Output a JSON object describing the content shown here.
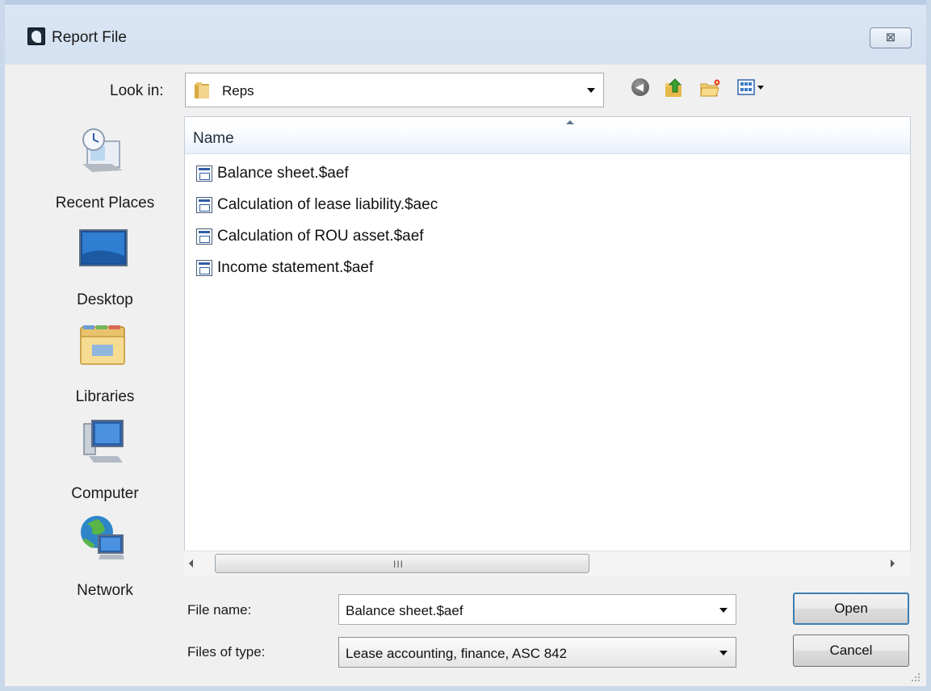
{
  "window": {
    "title": "Report File",
    "close_label": "⊠"
  },
  "look_in": {
    "label": "Look in:",
    "value": "Reps"
  },
  "toolbar": {
    "icons": [
      "back-icon",
      "up-folder-icon",
      "new-folder-icon",
      "views-menu-icon"
    ]
  },
  "places": [
    {
      "label": "Recent Places",
      "icon": "recent-places-icon"
    },
    {
      "label": "Desktop",
      "icon": "desktop-icon"
    },
    {
      "label": "Libraries",
      "icon": "libraries-icon"
    },
    {
      "label": "Computer",
      "icon": "computer-icon"
    },
    {
      "label": "Network",
      "icon": "network-icon"
    }
  ],
  "file_list": {
    "column_name": "Name",
    "files": [
      "Balance sheet.$aef",
      "Calculation of lease liability.$aec",
      "Calculation of ROU asset.$aef",
      "Income statement.$aef"
    ]
  },
  "scrollbar": {
    "grip": "III"
  },
  "file_name": {
    "label": "File name:",
    "value": "Balance sheet.$aef"
  },
  "file_type": {
    "label": "Files of type:",
    "value": "Lease accounting, finance, ASC 842"
  },
  "buttons": {
    "open": "Open",
    "cancel": "Cancel"
  }
}
